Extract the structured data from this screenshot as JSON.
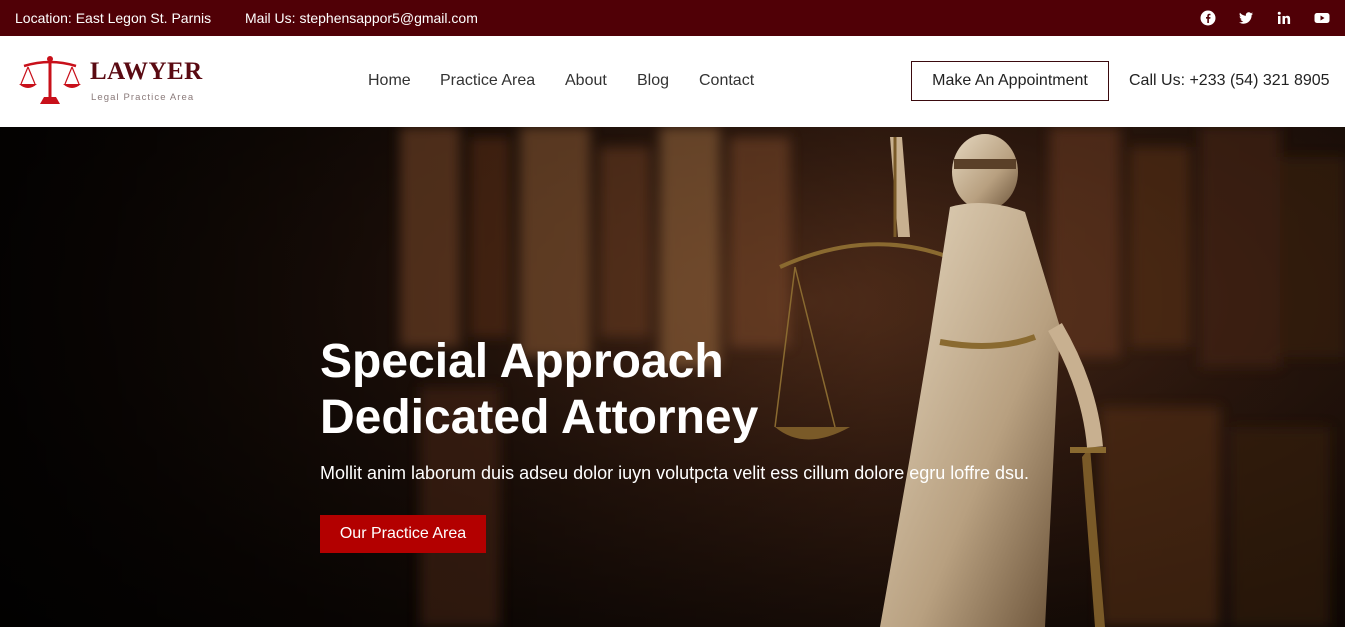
{
  "topbar": {
    "location": "Location: East Legon St. Parnis",
    "mail": "Mail Us: stephensappor5@gmail.com",
    "social_icons": [
      "facebook-icon",
      "twitter-icon",
      "linkedin-icon",
      "youtube-icon"
    ]
  },
  "header": {
    "logo_title": "LAWYER",
    "logo_subtitle": "Legal Practice Area",
    "nav": [
      "Home",
      "Practice Area",
      "About",
      "Blog",
      "Contact"
    ],
    "appointment_button": "Make An Appointment",
    "call": "Call Us: +233 (54) 321 8905"
  },
  "hero": {
    "title_line1": "Special Approach",
    "title_line2": "Dedicated Attorney",
    "text": "Mollit anim laborum duis adseu dolor iuyn volutpcta velit ess cillum dolore egru loffre dsu.",
    "button": "Our Practice Area"
  },
  "colors": {
    "topbar_bg": "#500006",
    "brand_dark": "#5a0a12",
    "accent_red": "#b30000"
  }
}
